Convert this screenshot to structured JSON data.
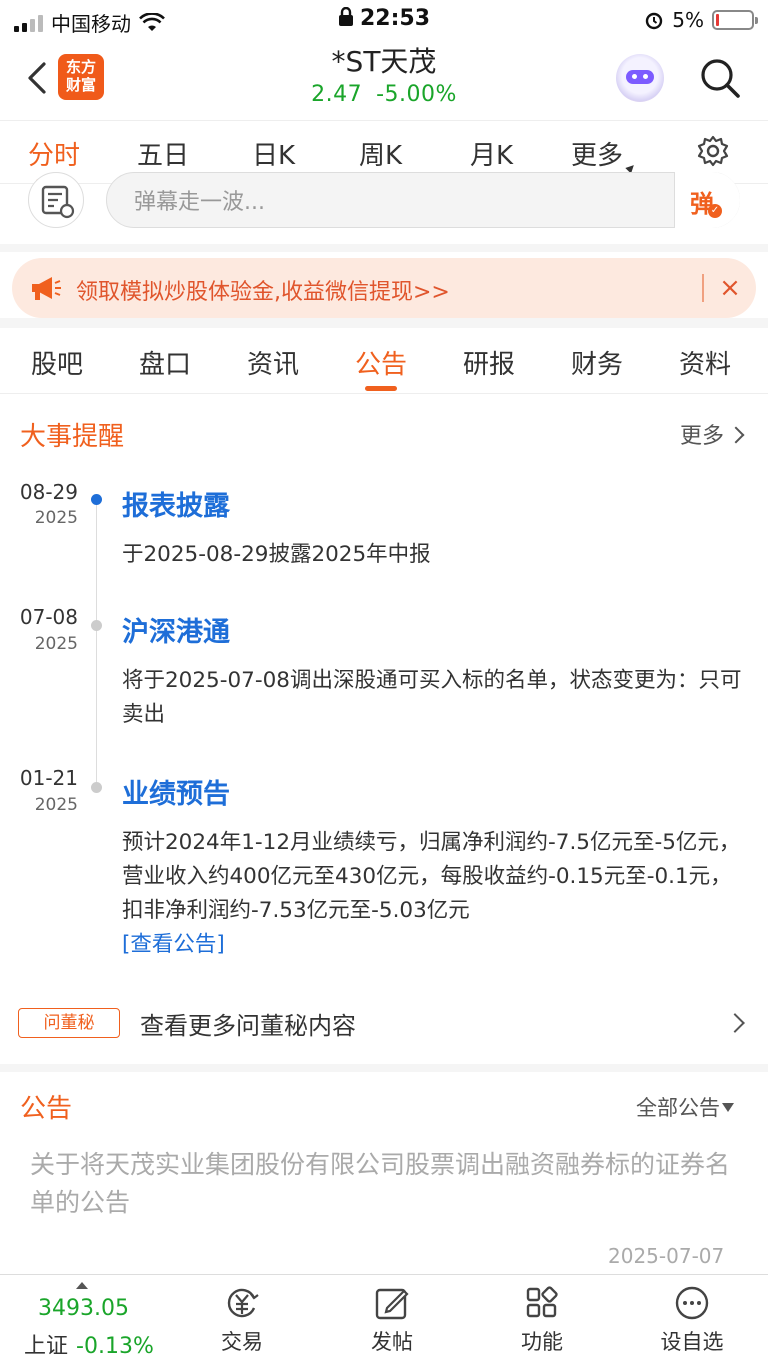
{
  "status_bar": {
    "carrier": "中国移动",
    "time": "22:53",
    "battery": "5%"
  },
  "header": {
    "logo_text_line1": "东方",
    "logo_text_line2": "财富",
    "stock_name": "*ST天茂",
    "price": "2.47",
    "change_pct": "-5.00%",
    "quote_color": "#1aa52a"
  },
  "chart_tabs": [
    {
      "label": "分时",
      "active": true
    },
    {
      "label": "五日"
    },
    {
      "label": "日K"
    },
    {
      "label": "周K"
    },
    {
      "label": "月K"
    },
    {
      "label": "更多"
    }
  ],
  "danmu": {
    "placeholder": "弹幕走一波...",
    "send_label": "弹"
  },
  "promo": {
    "text": "领取模拟炒股体验金,收益微信提现>>",
    "close": "×"
  },
  "info_tabs": [
    {
      "label": "股吧"
    },
    {
      "label": "盘口"
    },
    {
      "label": "资讯"
    },
    {
      "label": "公告",
      "active": true
    },
    {
      "label": "研报"
    },
    {
      "label": "财务"
    },
    {
      "label": "资料"
    }
  ],
  "events_section": {
    "title": "大事提醒",
    "more": "更多",
    "events": [
      {
        "date": "08-29",
        "year": "2025",
        "title": "报表披露",
        "desc": "于2025-08-29披露2025年中报"
      },
      {
        "date": "07-08",
        "year": "2025",
        "title": "沪深港通",
        "desc": "将于2025-07-08调出深股通可买入标的名单，状态变更为：只可卖出"
      },
      {
        "date": "01-21",
        "year": "2025",
        "title": "业绩预告",
        "desc": "预计2024年1-12月业绩续亏，归属净利润约-7.5亿元至-5亿元，营业收入约400亿元至430亿元，每股收益约-0.15元至-0.1元，扣非净利润约-7.53亿元至-5.03亿元",
        "link": "[查看公告]"
      }
    ]
  },
  "dm_secretary": {
    "badge": "问董秘",
    "text": "查看更多问董秘内容"
  },
  "announcements": {
    "title": "公告",
    "filter": "全部公告",
    "items": [
      {
        "title": "关于将天茂实业集团股份有限公司股票调出融资融券标的证券名单的公告",
        "date": "2025-07-07"
      }
    ]
  },
  "bottom_bar": {
    "index_value": "3493.05",
    "index_name": "上证",
    "index_change": "-0.13%",
    "items": [
      {
        "label": "交易",
        "icon": "trade-icon"
      },
      {
        "label": "发帖",
        "icon": "post-icon"
      },
      {
        "label": "功能",
        "icon": "apps-icon"
      },
      {
        "label": "设自选",
        "icon": "watchlist-icon"
      }
    ]
  }
}
